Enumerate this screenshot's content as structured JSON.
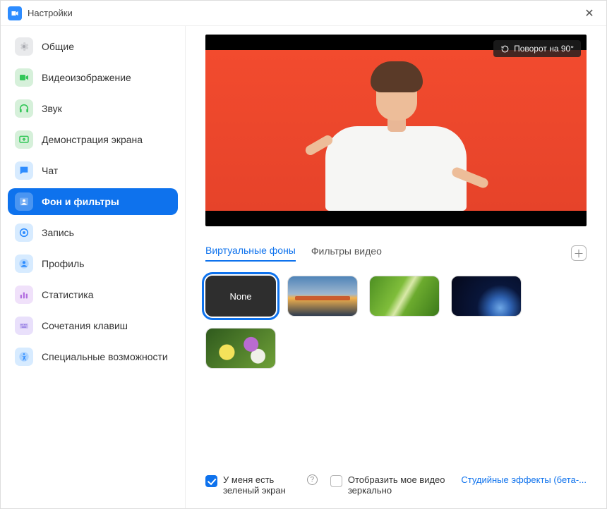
{
  "window": {
    "title": "Настройки"
  },
  "sidebar": {
    "items": [
      {
        "id": "general",
        "label": "Общие",
        "icon": "gear",
        "bg": "#e9eaec",
        "fg": "#a8aab0"
      },
      {
        "id": "video",
        "label": "Видеоизображение",
        "icon": "video",
        "bg": "#d6f0da",
        "fg": "#34c759"
      },
      {
        "id": "audio",
        "label": "Звук",
        "icon": "headphones",
        "bg": "#d6f0da",
        "fg": "#34c759"
      },
      {
        "id": "share",
        "label": "Демонстрация экрана",
        "icon": "share",
        "bg": "#d6f0da",
        "fg": "#34c759"
      },
      {
        "id": "chat",
        "label": "Чат",
        "icon": "chat",
        "bg": "#d7ebff",
        "fg": "#2d8cff"
      },
      {
        "id": "background",
        "label": "Фон и фильтры",
        "icon": "person",
        "bg": "#ffffff",
        "fg": "#ffffff",
        "selected": true
      },
      {
        "id": "recording",
        "label": "Запись",
        "icon": "record",
        "bg": "#d7ebff",
        "fg": "#2d8cff"
      },
      {
        "id": "profile",
        "label": "Профиль",
        "icon": "avatar",
        "bg": "#d7ebff",
        "fg": "#2d8cff"
      },
      {
        "id": "stats",
        "label": "Статистика",
        "icon": "stats",
        "bg": "#f0e1fa",
        "fg": "#b36fe0"
      },
      {
        "id": "shortcuts",
        "label": "Сочетания клавиш",
        "icon": "keyboard",
        "bg": "#e9e0fb",
        "fg": "#8a6fe0"
      },
      {
        "id": "a11y",
        "label": "Специальные возможности",
        "icon": "a11y",
        "bg": "#d7ebff",
        "fg": "#2d8cff"
      }
    ]
  },
  "preview": {
    "rotate_label": "Поворот на 90°"
  },
  "tabs": {
    "virtual": "Виртуальные фоны",
    "filters": "Фильтры видео"
  },
  "thumbs": {
    "none_label": "None"
  },
  "options": {
    "green_screen": "У меня есть зеленый экран",
    "mirror": "Отобразить мое видео зеркально",
    "studio_link": "Студийные эффекты (бета-..."
  }
}
